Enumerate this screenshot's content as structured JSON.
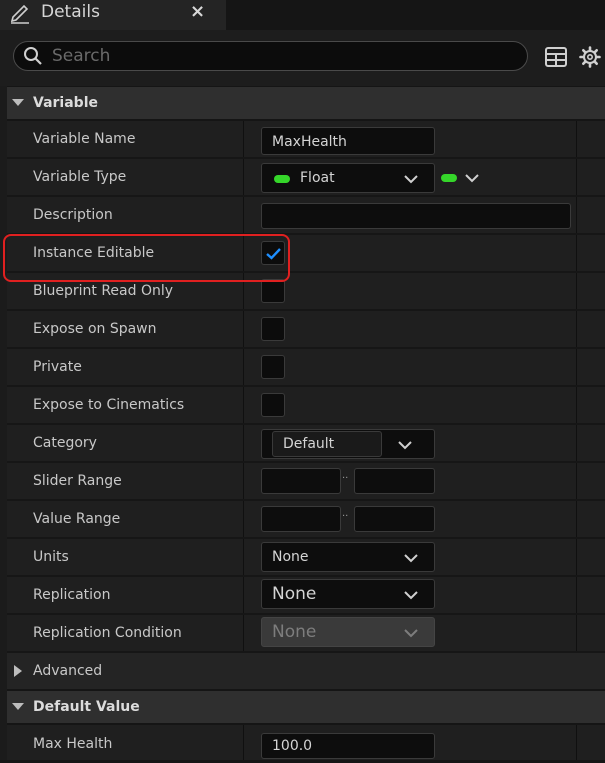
{
  "tab": {
    "title": "Details",
    "close": "×"
  },
  "search": {
    "placeholder": "Search"
  },
  "sections": {
    "variable": "Variable",
    "advanced": "Advanced",
    "default_value": "Default Value"
  },
  "rows": {
    "variable_name": {
      "label": "Variable Name",
      "value": "MaxHealth"
    },
    "variable_type": {
      "label": "Variable Type",
      "value": "Float"
    },
    "description": {
      "label": "Description",
      "value": ""
    },
    "instance_editable": {
      "label": "Instance Editable",
      "checked": true
    },
    "blueprint_read_only": {
      "label": "Blueprint Read Only",
      "checked": false
    },
    "expose_on_spawn": {
      "label": "Expose on Spawn",
      "checked": false
    },
    "private": {
      "label": "Private",
      "checked": false
    },
    "expose_to_cinematics": {
      "label": "Expose to Cinematics",
      "checked": false
    },
    "category": {
      "label": "Category",
      "value": "Default"
    },
    "slider_range": {
      "label": "Slider Range",
      "min": "",
      "max": "",
      "separator": ".."
    },
    "value_range": {
      "label": "Value Range",
      "min": "",
      "max": "",
      "separator": ".."
    },
    "units": {
      "label": "Units",
      "value": "None"
    },
    "replication": {
      "label": "Replication",
      "value": "None"
    },
    "replication_condition": {
      "label": "Replication Condition",
      "value": "None"
    },
    "max_health": {
      "label": "Max Health",
      "value": "100.0"
    }
  },
  "colors": {
    "float_pin": "#35d62a",
    "check": "#1e8fff",
    "highlight": "#e02020",
    "background": "#1f1f1f"
  },
  "icons": [
    "pencil-icon",
    "close-icon",
    "search-icon",
    "grid-icon",
    "gear-icon",
    "chevron-down-icon",
    "check-icon"
  ]
}
